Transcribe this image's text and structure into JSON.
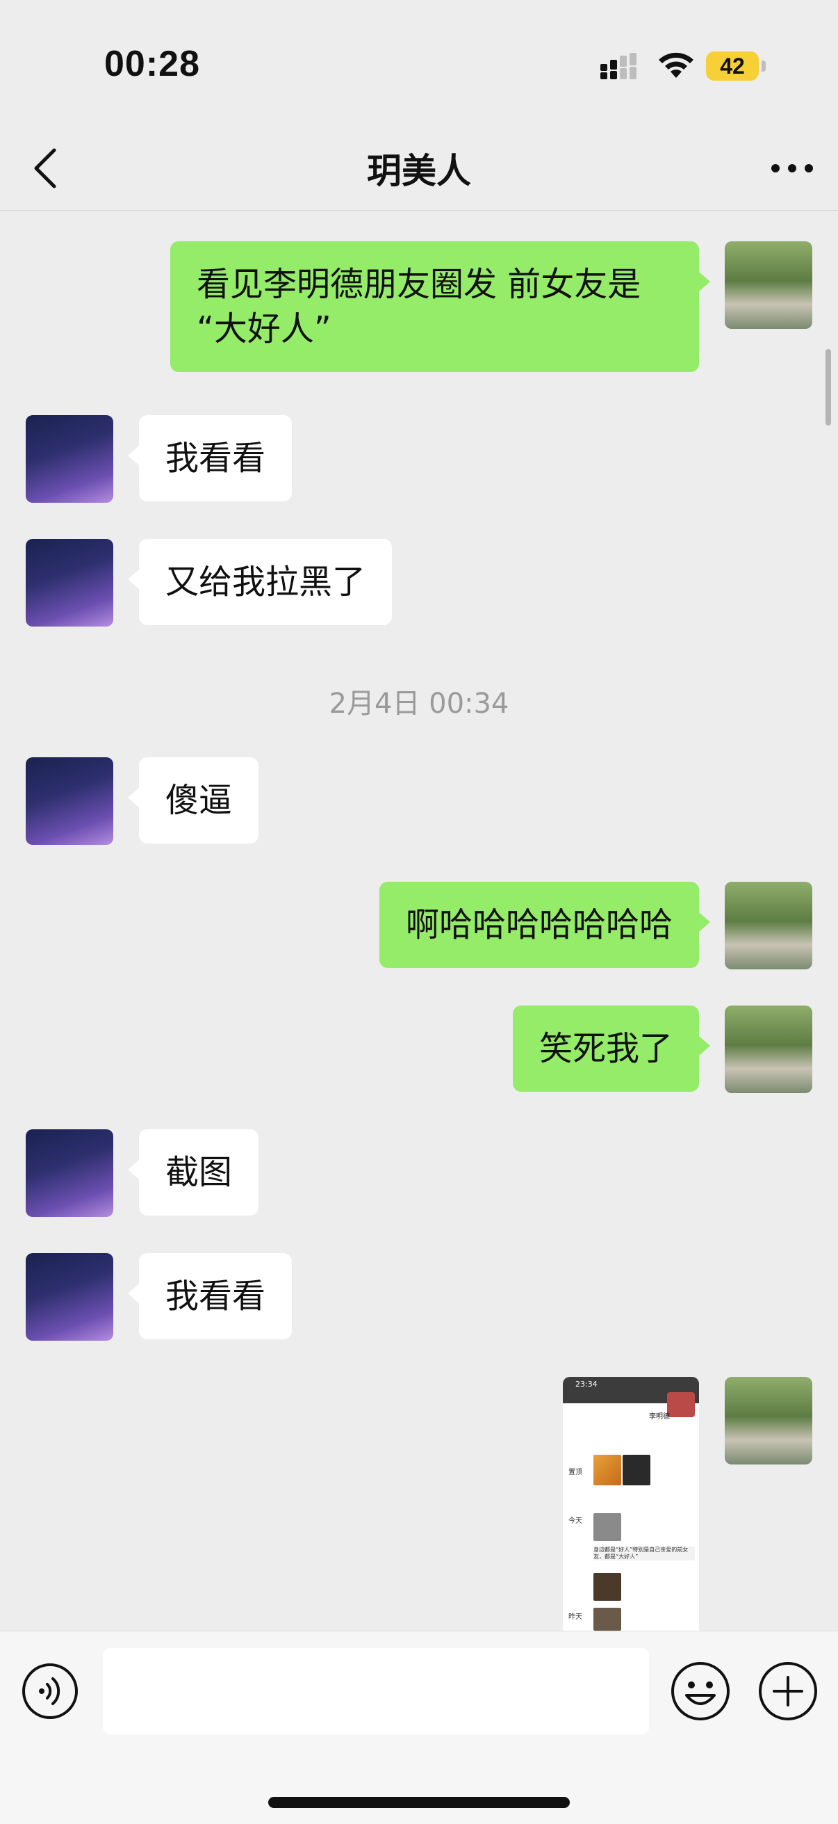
{
  "status_bar": {
    "time": "00:28",
    "battery": "42"
  },
  "nav": {
    "title": "玥美人"
  },
  "messages": [
    {
      "side": "right",
      "text": "看见李明德朋友圈发 前女友是\n“大好人”"
    },
    {
      "side": "left",
      "text": "我看看"
    },
    {
      "side": "left",
      "text": "又给我拉黑了"
    },
    {
      "side": "left",
      "text": "傻逼"
    },
    {
      "side": "right",
      "text": "啊哈哈哈哈哈哈哈"
    },
    {
      "side": "right",
      "text": "笑死我了"
    },
    {
      "side": "left",
      "text": "截图"
    },
    {
      "side": "left",
      "text": "我看看"
    }
  ],
  "timestamp": "2月4日 00:34",
  "screenshot": {
    "time": "23:34",
    "name": "李明德",
    "labels": [
      "置顶",
      "今天",
      "昨天"
    ],
    "caption": "身边都是“好人”特别是自己亲爱的前女友，都是“大好人”"
  },
  "colors": {
    "self_bubble": "#95ec69",
    "friend_bubble": "#ffffff",
    "background": "#ededed",
    "battery": "#f7cf36"
  }
}
